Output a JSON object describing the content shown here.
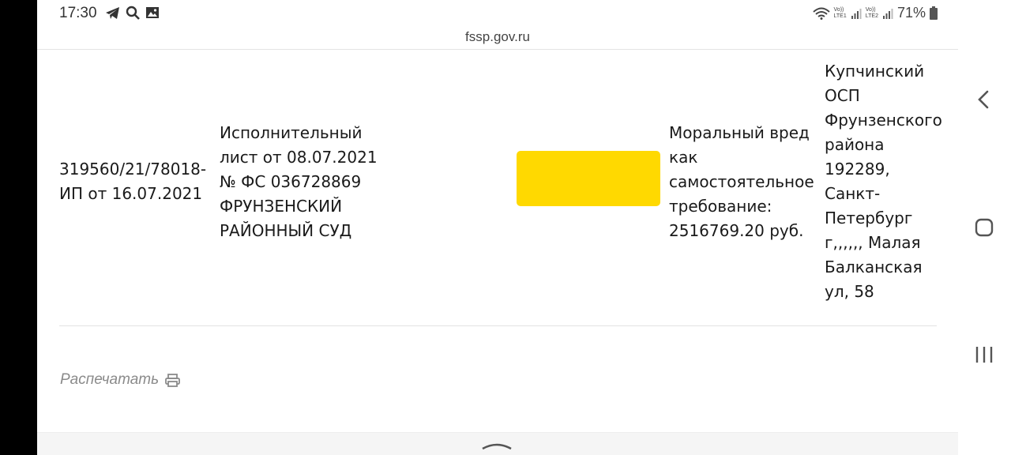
{
  "status_bar": {
    "time": "17:30",
    "left_icons": [
      "telegram-icon",
      "search-icon",
      "gallery-icon"
    ],
    "right_icons": [
      "wifi-icon",
      "volte1-icon",
      "signal1-icon",
      "volte2-icon",
      "signal2-icon"
    ],
    "lte1_label": "LTE1",
    "lte2_label": "LTE2",
    "vo_label": "Vo))",
    "battery_percent": "71%"
  },
  "browser": {
    "url": "fssp.gov.ru"
  },
  "table_row": {
    "proceeding": "319560/21/78018-\nИП от 16.07.2021",
    "document": "Исполнительный\nлист от 08.07.2021\n№ ФС 036728869\nФРУНЗЕНСКИЙ\nРАЙОННЫЙ СУД",
    "subject": "Моральный вред\nкак\nсамостоятельное\nтребование:\n2516769.20 руб.",
    "department": "Купчинский\nОСП\nФрунзенского\nрайона\n192289,\nСанкт-\nПетербург\nг,,,,,, Малая\nБалканская\nул, 58",
    "redaction_color": "#ffd900"
  },
  "actions": {
    "print_label": "Распечатать"
  },
  "nav_bar": {
    "buttons": [
      "back-icon",
      "home-icon",
      "recents-icon"
    ]
  }
}
